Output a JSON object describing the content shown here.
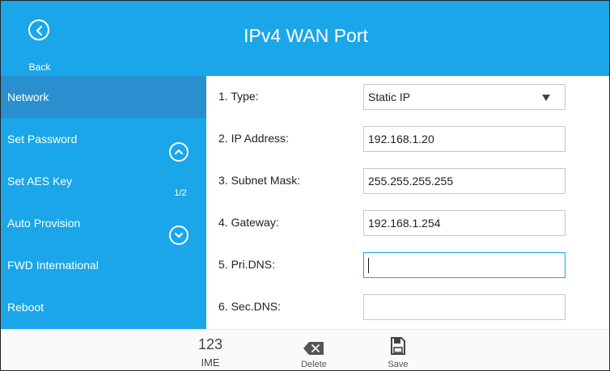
{
  "header": {
    "title": "IPv4 WAN Port",
    "back_label": "Back"
  },
  "sidebar": {
    "items": [
      {
        "label": "Network",
        "active": true
      },
      {
        "label": "Set Password",
        "active": false
      },
      {
        "label": "Set AES Key",
        "active": false
      },
      {
        "label": "Auto Provision",
        "active": false
      },
      {
        "label": "FWD International",
        "active": false
      },
      {
        "label": "Reboot",
        "active": false
      }
    ],
    "page_indicator": "1/2"
  },
  "form": {
    "rows": [
      {
        "label": "1. Type:",
        "value": "Static IP",
        "kind": "select"
      },
      {
        "label": "2. IP Address:",
        "value": "192.168.1.20",
        "kind": "text"
      },
      {
        "label": "3. Subnet Mask:",
        "value": "255.255.255.255",
        "kind": "text"
      },
      {
        "label": "4. Gateway:",
        "value": "192.168.1.254",
        "kind": "text"
      },
      {
        "label": "5. Pri.DNS:",
        "value": "",
        "kind": "text",
        "focused": true
      },
      {
        "label": "6. Sec.DNS:",
        "value": "",
        "kind": "text"
      }
    ]
  },
  "softkeys": {
    "ime_number": "123",
    "ime_label": "IME",
    "delete_label": "Delete",
    "save_label": "Save"
  },
  "colors": {
    "accent": "#1aa6e8",
    "active_item": "#2a8fce"
  }
}
